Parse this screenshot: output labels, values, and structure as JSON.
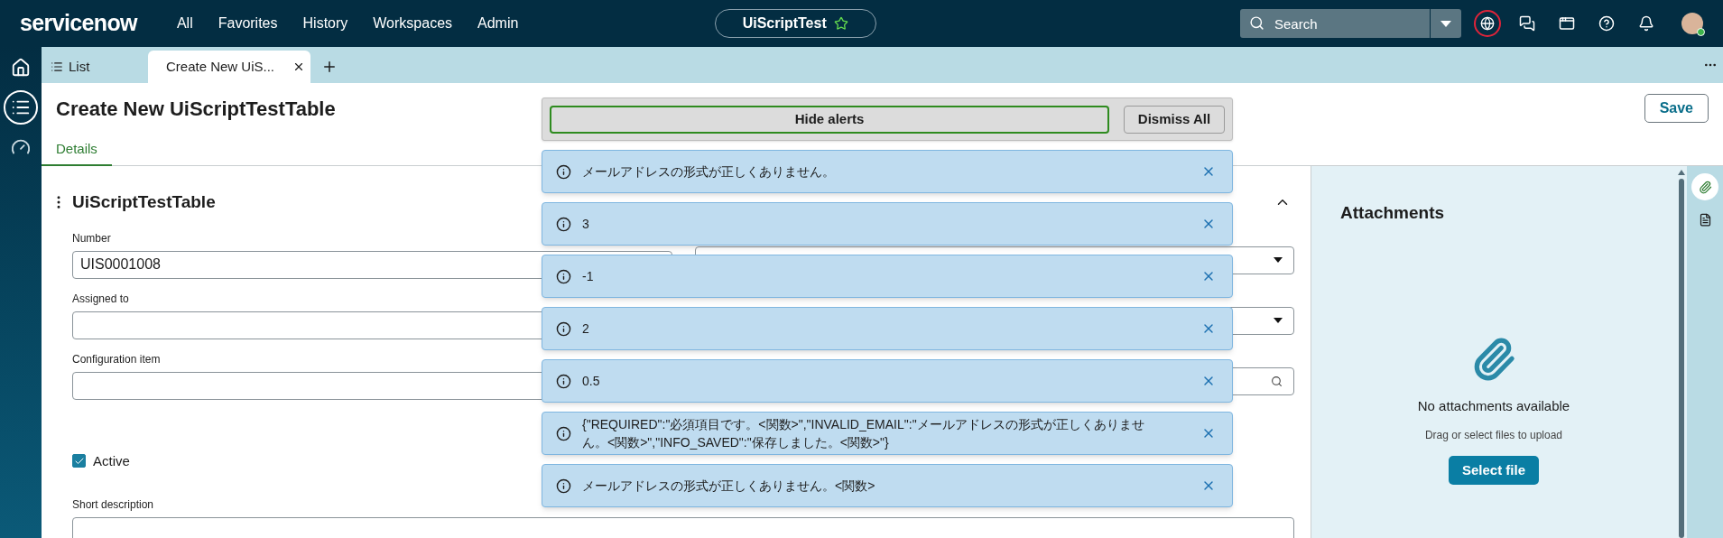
{
  "nav": {
    "logo": "servicenow",
    "menu": [
      "All",
      "Favorites",
      "History",
      "Workspaces",
      "Admin"
    ],
    "context_pill": "UiScriptTest",
    "search": {
      "placeholder": "Search"
    }
  },
  "tabs": [
    {
      "label": "List",
      "selected": false,
      "kind": "list"
    },
    {
      "label": "Create New UiS...",
      "selected": true,
      "kind": "record"
    }
  ],
  "page": {
    "title": "Create New UiScriptTestTable",
    "save": "Save",
    "tabs": [
      {
        "label": "Details",
        "selected": true
      }
    ]
  },
  "form": {
    "section_title": "UiScriptTestTable",
    "fields": [
      {
        "label": "Number",
        "value": "UIS0001008"
      },
      {
        "label": "Assigned to"
      },
      {
        "label": "Configuration item"
      }
    ],
    "right_fields": [
      {
        "kind": "select"
      },
      {
        "kind": "select"
      },
      {
        "kind": "lookup"
      }
    ],
    "active": {
      "label": "Active",
      "checked": true
    },
    "short_description": {
      "label": "Short description"
    }
  },
  "alerts": {
    "hide": "Hide alerts",
    "dismiss": "Dismiss All",
    "items": [
      "メールアドレスの形式が正しくありません。",
      "3",
      "-1",
      "2",
      "0.5",
      "{\"REQUIRED\":\"必須項目です。<関数>\",\"INVALID_EMAIL\":\"メールアドレスの形式が正しくありません。<関数>\",\"INFO_SAVED\":\"保存しました。<関数>\"}",
      "メールアドレスの形式が正しくありません。<関数>"
    ]
  },
  "attachments": {
    "title": "Attachments",
    "empty": "No attachments available",
    "hint": "Drag or select files to upload",
    "button": "Select file"
  }
}
